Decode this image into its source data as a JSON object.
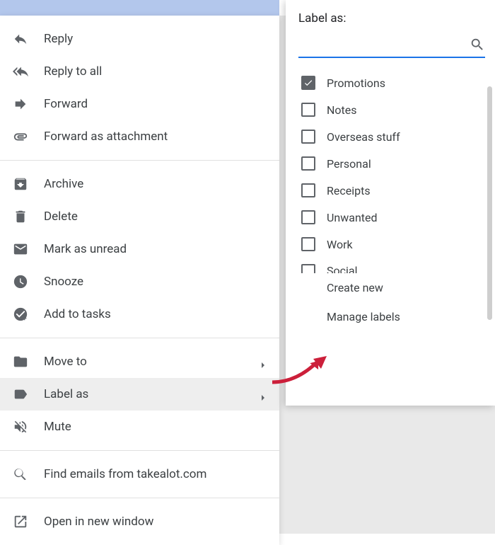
{
  "contextMenu": {
    "reply": "Reply",
    "replyAll": "Reply to all",
    "forward": "Forward",
    "forwardAttachment": "Forward as attachment",
    "archive": "Archive",
    "delete": "Delete",
    "markUnread": "Mark as unread",
    "snooze": "Snooze",
    "addTasks": "Add to tasks",
    "moveTo": "Move to",
    "labelAs": "Label as",
    "mute": "Mute",
    "findEmails": "Find emails from takealot.com",
    "openNewWindow": "Open in new window"
  },
  "labelPanel": {
    "title": "Label as:",
    "searchPlaceholder": "",
    "labels": [
      {
        "name": "Promotions",
        "checked": true
      },
      {
        "name": "Notes",
        "checked": false
      },
      {
        "name": "Overseas stuff",
        "checked": false
      },
      {
        "name": "Personal",
        "checked": false
      },
      {
        "name": "Receipts",
        "checked": false
      },
      {
        "name": "Unwanted",
        "checked": false
      },
      {
        "name": "Work",
        "checked": false
      },
      {
        "name": "Social",
        "checked": false
      }
    ],
    "createNew": "Create new",
    "manageLabels": "Manage labels"
  }
}
